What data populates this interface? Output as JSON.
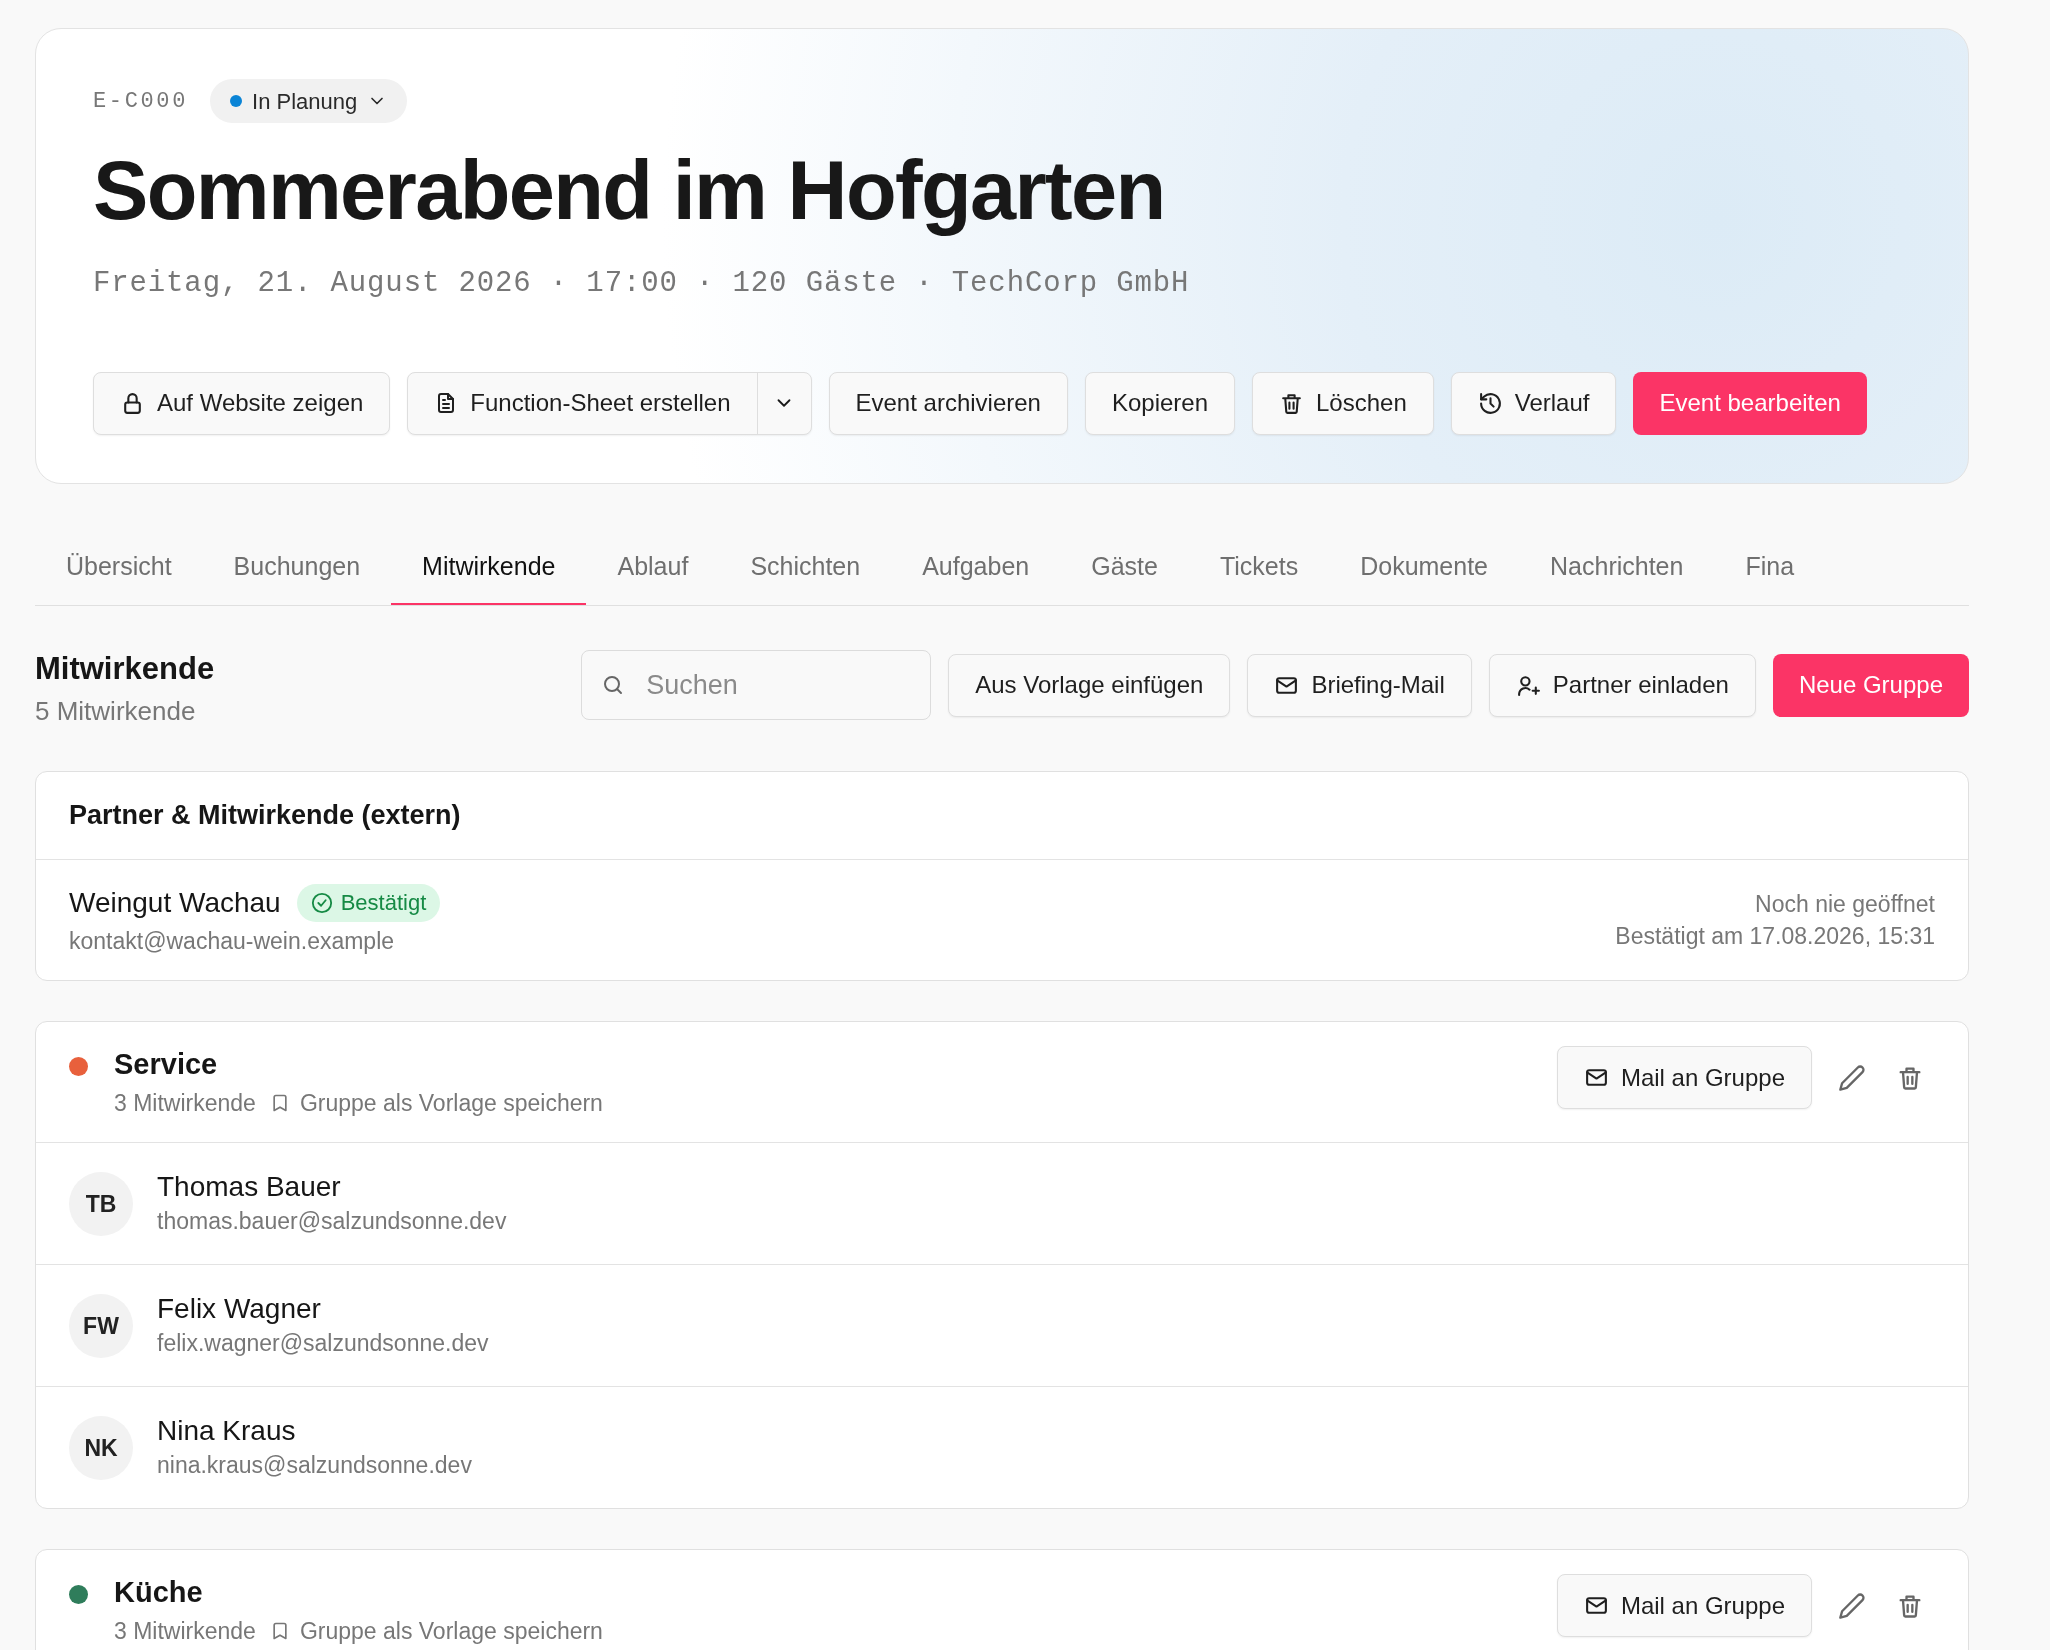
{
  "header": {
    "event_id": "E-C000",
    "status": {
      "label": "In Planung",
      "color": "#0a84d6"
    },
    "title": "Sommerabend im Hofgarten",
    "meta": "Freitag, 21. August 2026 · 17:00 · 120 Gäste · TechCorp GmbH",
    "actions": [
      {
        "label": "Auf Website zeigen",
        "kind": "default"
      },
      {
        "label": "Function-Sheet erstellen",
        "kind": "split"
      },
      {
        "label": "Event archivieren",
        "kind": "default"
      },
      {
        "label": "Kopieren",
        "kind": "default"
      },
      {
        "label": "Löschen",
        "kind": "default"
      },
      {
        "label": "Verlauf",
        "kind": "default"
      },
      {
        "label": "Event bearbeiten",
        "kind": "primary"
      }
    ]
  },
  "tabs": [
    {
      "label": "Übersicht",
      "selected": false
    },
    {
      "label": "Buchungen",
      "selected": false
    },
    {
      "label": "Mitwirkende",
      "selected": true
    },
    {
      "label": "Ablauf",
      "selected": false
    },
    {
      "label": "Schichten",
      "selected": false
    },
    {
      "label": "Aufgaben",
      "selected": false
    },
    {
      "label": "Gäste",
      "selected": false
    },
    {
      "label": "Tickets",
      "selected": false
    },
    {
      "label": "Dokumente",
      "selected": false
    },
    {
      "label": "Nachrichten",
      "selected": false
    },
    {
      "label": "Fina",
      "selected": false
    }
  ],
  "section": {
    "title": "Mitwirkende",
    "count": "5 Mitwirkende",
    "search": {
      "placeholder": "Suchen"
    },
    "actions": [
      {
        "label": "Aus Vorlage einfügen",
        "kind": "default"
      },
      {
        "label": "Briefing-Mail",
        "kind": "default"
      },
      {
        "label": "Partner einladen",
        "kind": "default"
      },
      {
        "label": "Neue Gruppe",
        "kind": "primary"
      }
    ]
  },
  "partners": {
    "title": "Partner & Mitwirkende (extern)",
    "items": [
      {
        "name": "Weingut Wachau",
        "status": "Bestätigt",
        "email": "kontakt@wachau-wein.example",
        "opened": "Noch nie geöffnet",
        "confirmed": "Bestätigt am 17.08.2026, 15:31"
      }
    ]
  },
  "groups": [
    {
      "name": "Service",
      "color": "#e8603c",
      "count": "3 Mitwirkende",
      "template_link": "Gruppe als Vorlage speichern",
      "mail_button": "Mail an Gruppe",
      "members": [
        {
          "initials": "TB",
          "name": "Thomas Bauer",
          "email": "thomas.bauer@salzundsonne.dev"
        },
        {
          "initials": "FW",
          "name": "Felix Wagner",
          "email": "felix.wagner@salzundsonne.dev"
        },
        {
          "initials": "NK",
          "name": "Nina Kraus",
          "email": "nina.kraus@salzundsonne.dev"
        }
      ]
    },
    {
      "name": "Küche",
      "color": "#2f7d5b",
      "count": "3 Mitwirkende",
      "template_link": "Gruppe als Vorlage speichern",
      "mail_button": "Mail an Gruppe"
    }
  ]
}
